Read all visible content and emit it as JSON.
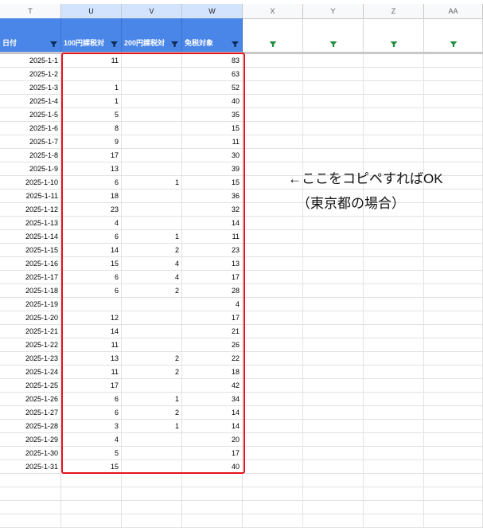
{
  "columns": {
    "letters": [
      "T",
      "U",
      "V",
      "W",
      "X",
      "Y",
      "Z",
      "AA"
    ],
    "selected": [
      "U",
      "V",
      "W"
    ]
  },
  "header": {
    "labels": [
      "日付",
      "100円課税対",
      "200円課税対",
      "免税対象",
      "",
      "",
      "",
      ""
    ]
  },
  "rows": [
    [
      "2025-1-1",
      "11",
      "",
      "83"
    ],
    [
      "2025-1-2",
      "",
      "",
      "63"
    ],
    [
      "2025-1-3",
      "1",
      "",
      "52"
    ],
    [
      "2025-1-4",
      "1",
      "",
      "40"
    ],
    [
      "2025-1-5",
      "5",
      "",
      "35"
    ],
    [
      "2025-1-6",
      "8",
      "",
      "15"
    ],
    [
      "2025-1-7",
      "9",
      "",
      "11"
    ],
    [
      "2025-1-8",
      "17",
      "",
      "30"
    ],
    [
      "2025-1-9",
      "13",
      "",
      "39"
    ],
    [
      "2025-1-10",
      "6",
      "1",
      "15"
    ],
    [
      "2025-1-11",
      "18",
      "",
      "36"
    ],
    [
      "2025-1-12",
      "23",
      "",
      "32"
    ],
    [
      "2025-1-13",
      "4",
      "",
      "14"
    ],
    [
      "2025-1-14",
      "6",
      "1",
      "11"
    ],
    [
      "2025-1-15",
      "14",
      "2",
      "23"
    ],
    [
      "2025-1-16",
      "15",
      "4",
      "13"
    ],
    [
      "2025-1-17",
      "6",
      "4",
      "17"
    ],
    [
      "2025-1-18",
      "6",
      "2",
      "28"
    ],
    [
      "2025-1-19",
      "",
      "",
      "4"
    ],
    [
      "2025-1-20",
      "12",
      "",
      "17"
    ],
    [
      "2025-1-21",
      "14",
      "",
      "21"
    ],
    [
      "2025-1-22",
      "11",
      "",
      "26"
    ],
    [
      "2025-1-23",
      "13",
      "2",
      "22"
    ],
    [
      "2025-1-24",
      "11",
      "2",
      "18"
    ],
    [
      "2025-1-25",
      "17",
      "",
      "42"
    ],
    [
      "2025-1-26",
      "6",
      "1",
      "34"
    ],
    [
      "2025-1-27",
      "6",
      "2",
      "14"
    ],
    [
      "2025-1-28",
      "3",
      "1",
      "14"
    ],
    [
      "2025-1-29",
      "4",
      "",
      "20"
    ],
    [
      "2025-1-30",
      "5",
      "",
      "17"
    ],
    [
      "2025-1-31",
      "15",
      "",
      "40"
    ]
  ],
  "empty_rows": 4,
  "annotation": {
    "line1": "←ここをコピペすればOK",
    "line2": "（東京都の場合）"
  },
  "colors": {
    "header_fill": "#4a86e8",
    "highlight_border": "#e8131b",
    "filter_icon_green": "#1e8e3e"
  }
}
